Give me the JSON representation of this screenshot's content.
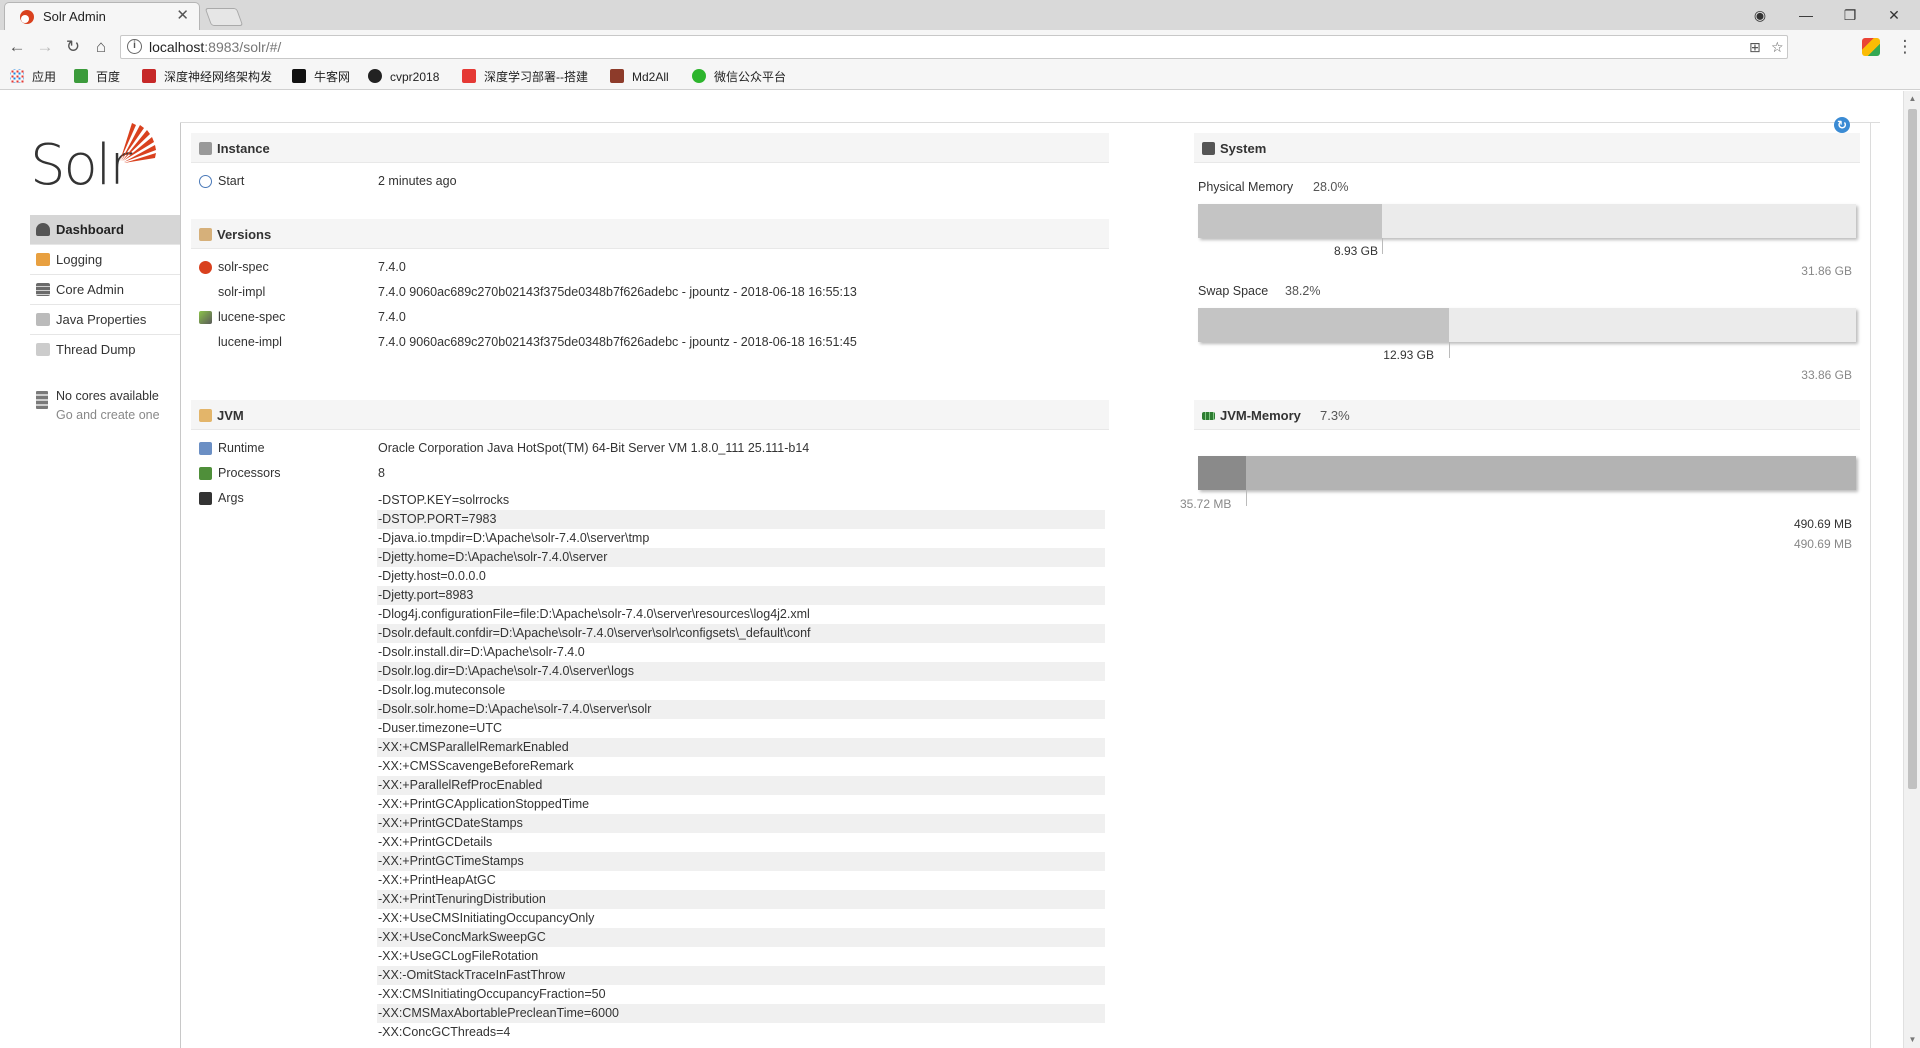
{
  "browser": {
    "tab_title": "Solr Admin",
    "url_host": "localhost",
    "url_rest": ":8983/solr/#/",
    "bookmarks": [
      "应用",
      "百度",
      "深度神经网络架构发",
      "牛客网",
      "cvpr2018",
      "深度学习部署--搭建",
      "Md2All",
      "微信公众平台"
    ]
  },
  "logo": {
    "text": "Solr"
  },
  "nav": {
    "items": [
      "Dashboard",
      "Logging",
      "Core Admin",
      "Java Properties",
      "Thread Dump"
    ],
    "no_cores": "No cores available",
    "create": "Go and create one"
  },
  "instance": {
    "title": "Instance",
    "start_label": "Start",
    "start_value": "2 minutes ago"
  },
  "versions": {
    "title": "Versions",
    "rows": [
      {
        "key": "solr-spec",
        "value": "7.4.0"
      },
      {
        "key": "solr-impl",
        "value": "7.4.0 9060ac689c270b02143f375de0348b7f626adebc - jpountz - 2018-06-18 16:55:13"
      },
      {
        "key": "lucene-spec",
        "value": "7.4.0"
      },
      {
        "key": "lucene-impl",
        "value": "7.4.0 9060ac689c270b02143f375de0348b7f626adebc - jpountz - 2018-06-18 16:51:45"
      }
    ]
  },
  "jvm": {
    "title": "JVM",
    "runtime_label": "Runtime",
    "runtime_value": "Oracle Corporation Java HotSpot(TM) 64-Bit Server VM 1.8.0_111 25.111-b14",
    "processors_label": "Processors",
    "processors_value": "8",
    "args_label": "Args",
    "args": [
      "-DSTOP.KEY=solrrocks",
      "-DSTOP.PORT=7983",
      "-Djava.io.tmpdir=D:\\Apache\\solr-7.4.0\\server\\tmp",
      "-Djetty.home=D:\\Apache\\solr-7.4.0\\server",
      "-Djetty.host=0.0.0.0",
      "-Djetty.port=8983",
      "-Dlog4j.configurationFile=file:D:\\Apache\\solr-7.4.0\\server\\resources\\log4j2.xml",
      "-Dsolr.default.confdir=D:\\Apache\\solr-7.4.0\\server\\solr\\configsets\\_default\\conf",
      "-Dsolr.install.dir=D:\\Apache\\solr-7.4.0",
      "-Dsolr.log.dir=D:\\Apache\\solr-7.4.0\\server\\logs",
      "-Dsolr.log.muteconsole",
      "-Dsolr.solr.home=D:\\Apache\\solr-7.4.0\\server\\solr",
      "-Duser.timezone=UTC",
      "-XX:+CMSParallelRemarkEnabled",
      "-XX:+CMSScavengeBeforeRemark",
      "-XX:+ParallelRefProcEnabled",
      "-XX:+PrintGCApplicationStoppedTime",
      "-XX:+PrintGCDateStamps",
      "-XX:+PrintGCDetails",
      "-XX:+PrintGCTimeStamps",
      "-XX:+PrintHeapAtGC",
      "-XX:+PrintTenuringDistribution",
      "-XX:+UseCMSInitiatingOccupancyOnly",
      "-XX:+UseConcMarkSweepGC",
      "-XX:+UseGCLogFileRotation",
      "-XX:-OmitStackTraceInFastThrow",
      "-XX:CMSInitiatingOccupancyFraction=50",
      "-XX:CMSMaxAbortablePrecleanTime=6000",
      "-XX:ConcGCThreads=4"
    ]
  },
  "system": {
    "title": "System",
    "physical": {
      "label": "Physical Memory",
      "pct": "28.0%",
      "used": "8.93 GB",
      "total": "31.86 GB",
      "fraction": 0.28
    },
    "swap": {
      "label": "Swap Space",
      "pct": "38.2%",
      "used": "12.93 GB",
      "total": "33.86 GB",
      "fraction": 0.382
    }
  },
  "jvm_memory": {
    "title": "JVM-Memory",
    "pct": "7.3%",
    "used": "35.72 MB",
    "allocated": "490.69 MB",
    "max": "490.69 MB",
    "used_fraction": 0.073
  },
  "colors": {
    "solr_red": "#d9411e",
    "bar_fill": "#c4c4c4",
    "bar_track": "#ebebeb"
  }
}
